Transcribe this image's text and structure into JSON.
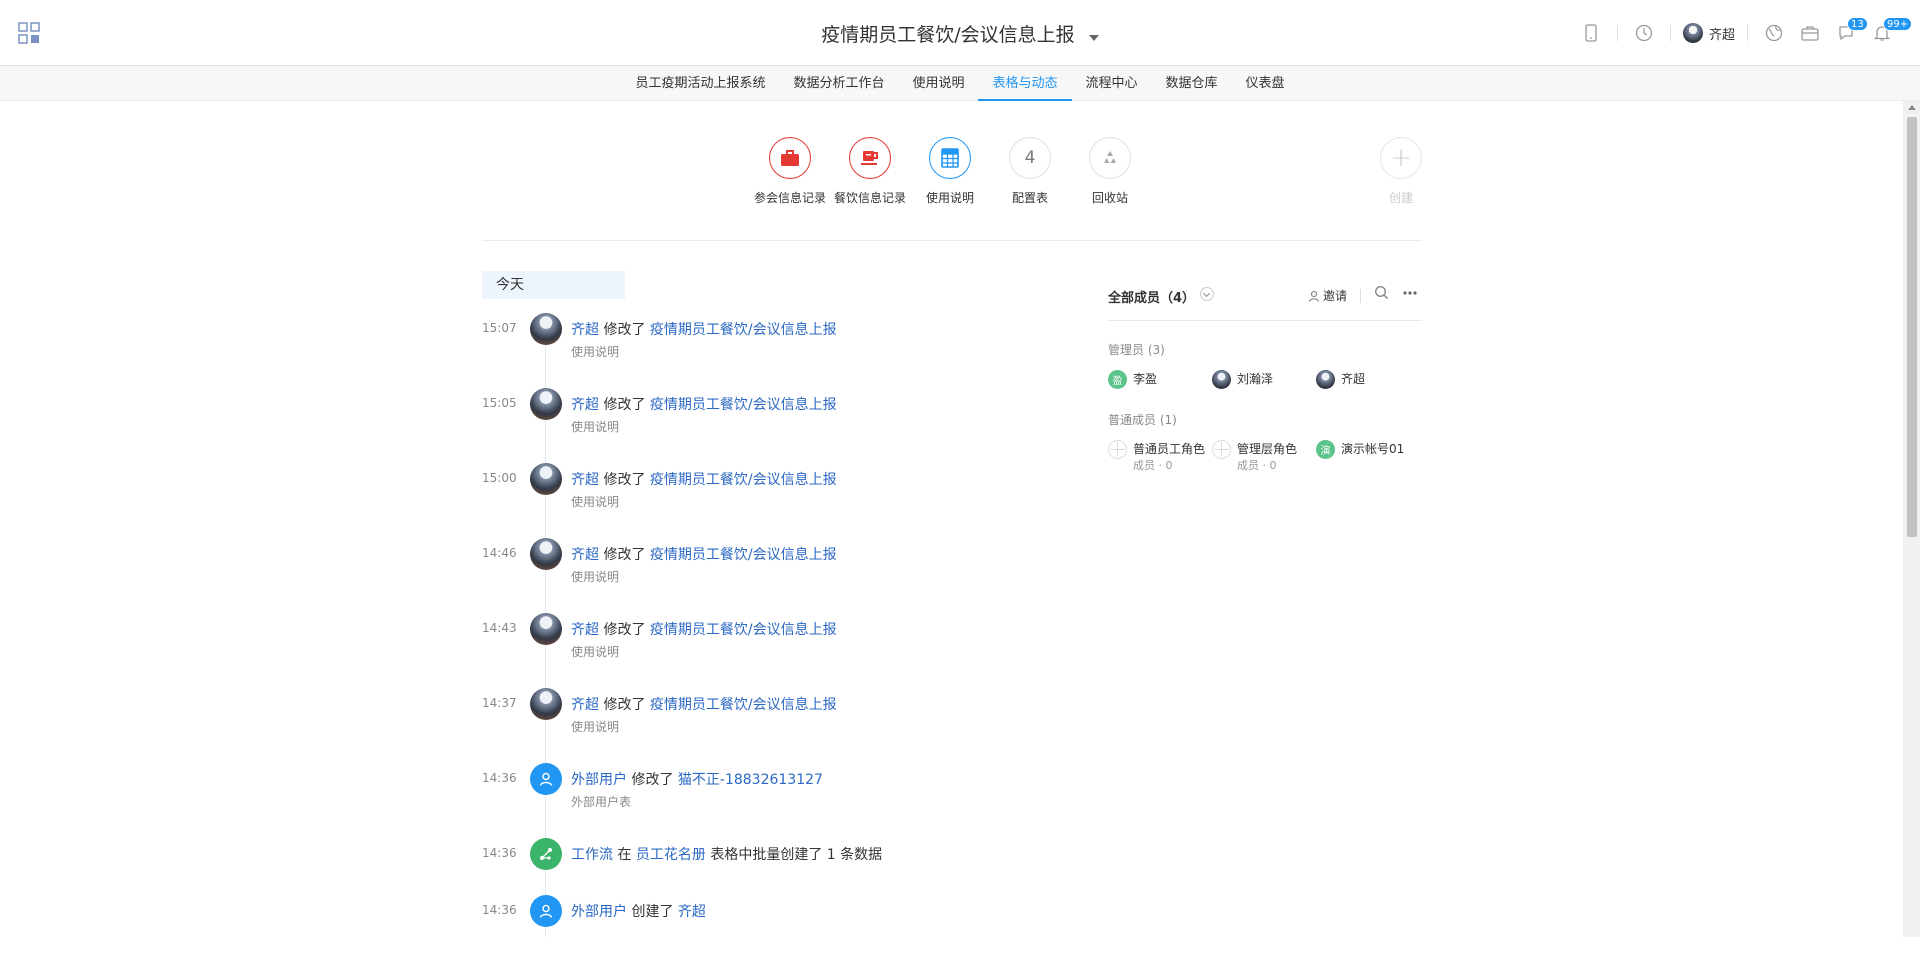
{
  "header": {
    "title": "疫情期员工餐饮/会议信息上报",
    "user_name": "齐超",
    "badge_chat": "13",
    "badge_notify": "99+"
  },
  "nav": {
    "items": [
      {
        "label": "员工疫期活动上报系统"
      },
      {
        "label": "数据分析工作台"
      },
      {
        "label": "使用说明"
      },
      {
        "label": "表格与动态",
        "active": true
      },
      {
        "label": "流程中心"
      },
      {
        "label": "数据仓库"
      },
      {
        "label": "仪表盘"
      }
    ]
  },
  "apps": [
    {
      "label": "参会信息记录",
      "color": "#e53935",
      "icon": "briefcase-icon"
    },
    {
      "label": "餐饮信息记录",
      "color": "#e53935",
      "icon": "coffee-cup-icon"
    },
    {
      "label": "使用说明",
      "color": "#2196f3",
      "icon": "table-icon"
    },
    {
      "label": "配置表",
      "number": "4"
    },
    {
      "label": "回收站",
      "icon": "recycle-icon"
    }
  ],
  "create_label": "创建",
  "timeline": {
    "today_label": "今天",
    "items": [
      {
        "time": "15:07",
        "actor": "齐超",
        "action": "修改了",
        "target": "疫情期员工餐饮/会议信息上报",
        "sub": "使用说明"
      },
      {
        "time": "15:05",
        "actor": "齐超",
        "action": "修改了",
        "target": "疫情期员工餐饮/会议信息上报",
        "sub": "使用说明"
      },
      {
        "time": "15:00",
        "actor": "齐超",
        "action": "修改了",
        "target": "疫情期员工餐饮/会议信息上报",
        "sub": "使用说明"
      },
      {
        "time": "14:46",
        "actor": "齐超",
        "action": "修改了",
        "target": "疫情期员工餐饮/会议信息上报",
        "sub": "使用说明"
      },
      {
        "time": "14:43",
        "actor": "齐超",
        "action": "修改了",
        "target": "疫情期员工餐饮/会议信息上报",
        "sub": "使用说明"
      },
      {
        "time": "14:37",
        "actor": "齐超",
        "action": "修改了",
        "target": "疫情期员工餐饮/会议信息上报",
        "sub": "使用说明"
      },
      {
        "time": "14:36",
        "actor": "外部用户",
        "action": "修改了",
        "target": "猫不正-18832613127",
        "sub": "外部用户表"
      },
      {
        "time": "14:36",
        "actor": "工作流",
        "action": "在",
        "target": "员工花名册",
        "suffix": "表格中批量创建了 1 条数据"
      },
      {
        "time": "14:36",
        "actor": "外部用户",
        "action": "创建了",
        "target": "齐超"
      }
    ]
  },
  "members": {
    "title": "全部成员（4）",
    "invite_label": "邀请",
    "admins_title": "管理员 (3)",
    "admins": [
      {
        "name": "李盈",
        "initial": "盈"
      },
      {
        "name": "刘瀚泽"
      },
      {
        "name": "齐超"
      }
    ],
    "normal_title": "普通成员 (1)",
    "normal": [
      {
        "name": "普通员工角色",
        "count": "成员 · 0"
      },
      {
        "name": "管理层角色",
        "count": "成员 · 0"
      },
      {
        "name": "演示帐号01",
        "initial": "演"
      }
    ]
  }
}
